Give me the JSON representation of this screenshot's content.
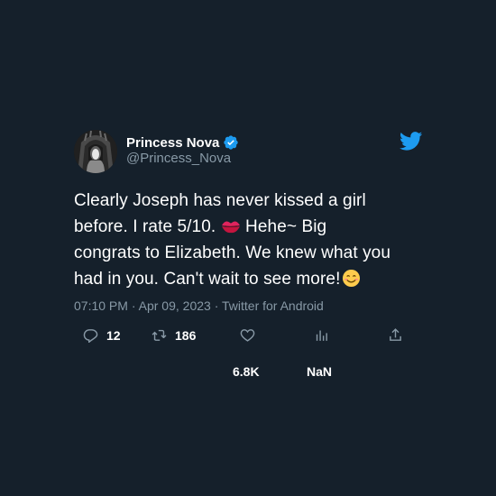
{
  "user": {
    "display_name": "Princess Nova",
    "handle": "@Princess_Nova",
    "verified": true
  },
  "tweet": {
    "line1": "Clearly Joseph has never kissed a girl",
    "line2a": "before. I rate 5/10.",
    "line2b": "Hehe~ Big",
    "line3": "congrats to Elizabeth. We knew what you",
    "line4": "had in you. Can't wait to see more!",
    "emojis": [
      "kiss-mark-emoji",
      "smiling-face-emoji"
    ]
  },
  "meta": {
    "time": "07:10 PM",
    "separator": "·",
    "date": "Apr 09, 2023",
    "source": "Twitter for Android"
  },
  "actions": {
    "replies": "12",
    "retweets": "186",
    "likes": "6.8K",
    "views": "NaN"
  },
  "colors": {
    "background": "#15202b",
    "text": "#ffffff",
    "muted": "#8899a6",
    "brand": "#1d9bf0"
  },
  "icons": [
    "reply-icon",
    "retweet-icon",
    "like-icon",
    "views-icon",
    "share-icon",
    "twitter-bird-icon",
    "verified-badge-icon"
  ]
}
